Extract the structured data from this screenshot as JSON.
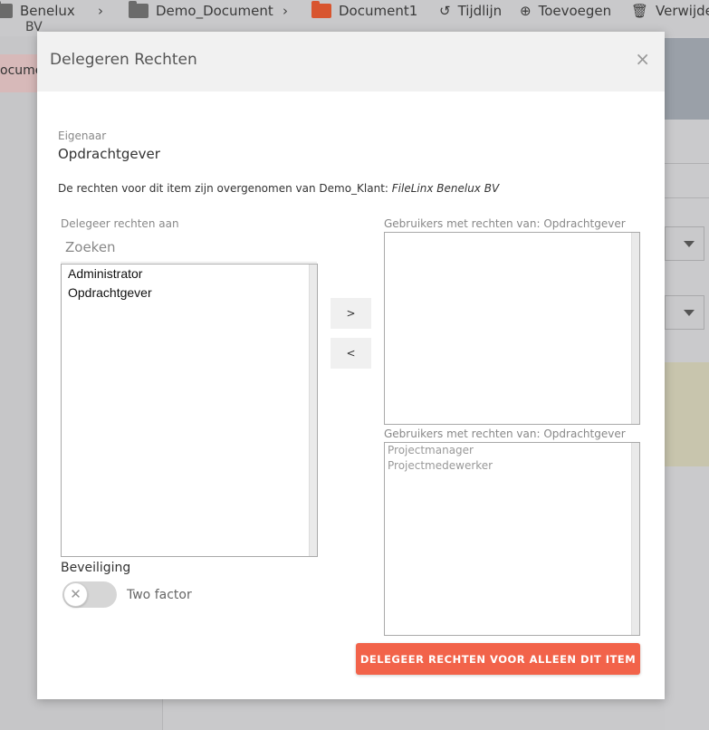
{
  "background": {
    "breadcrumb": {
      "item1": "Benelux",
      "item1_sub": "BV",
      "item2": "Demo_Document",
      "item3": "Document1"
    },
    "toolbar": {
      "timeline": "Tijdlijn",
      "add": "Toevoegen",
      "delete": "Verwijde"
    },
    "left_tab": "ocume"
  },
  "modal": {
    "title": "Delegeren Rechten",
    "close_icon": "×",
    "owner_label": "Eigenaar",
    "owner_value": "Opdrachtgever",
    "inherit_prefix": "De rechten voor dit item zijn overgenomen van Demo_Klant: ",
    "inherit_source": "FileLinx Benelux BV",
    "delegate_label": "Delegeer rechten aan",
    "search_placeholder": "Zoeken",
    "available_users": [
      "Administrator",
      "Opdrachtgever"
    ],
    "move_right": ">",
    "move_left": "<",
    "rights_label_1": "Gebruikers met rechten van: Opdrachtgever",
    "rights_users_1": [],
    "rights_label_2": "Gebruikers met rechten van: Opdrachtgever",
    "rights_users_2": [
      "Projectmanager",
      "Projectmedewerker"
    ],
    "security_label": "Beveiliging",
    "two_factor_label": "Two factor",
    "two_factor_enabled": false,
    "submit_label": "DELEGEER RECHTEN VOOR ALLEEN DIT ITEM"
  },
  "colors": {
    "accent": "#f2634a",
    "folder_open": "#d8552f"
  }
}
